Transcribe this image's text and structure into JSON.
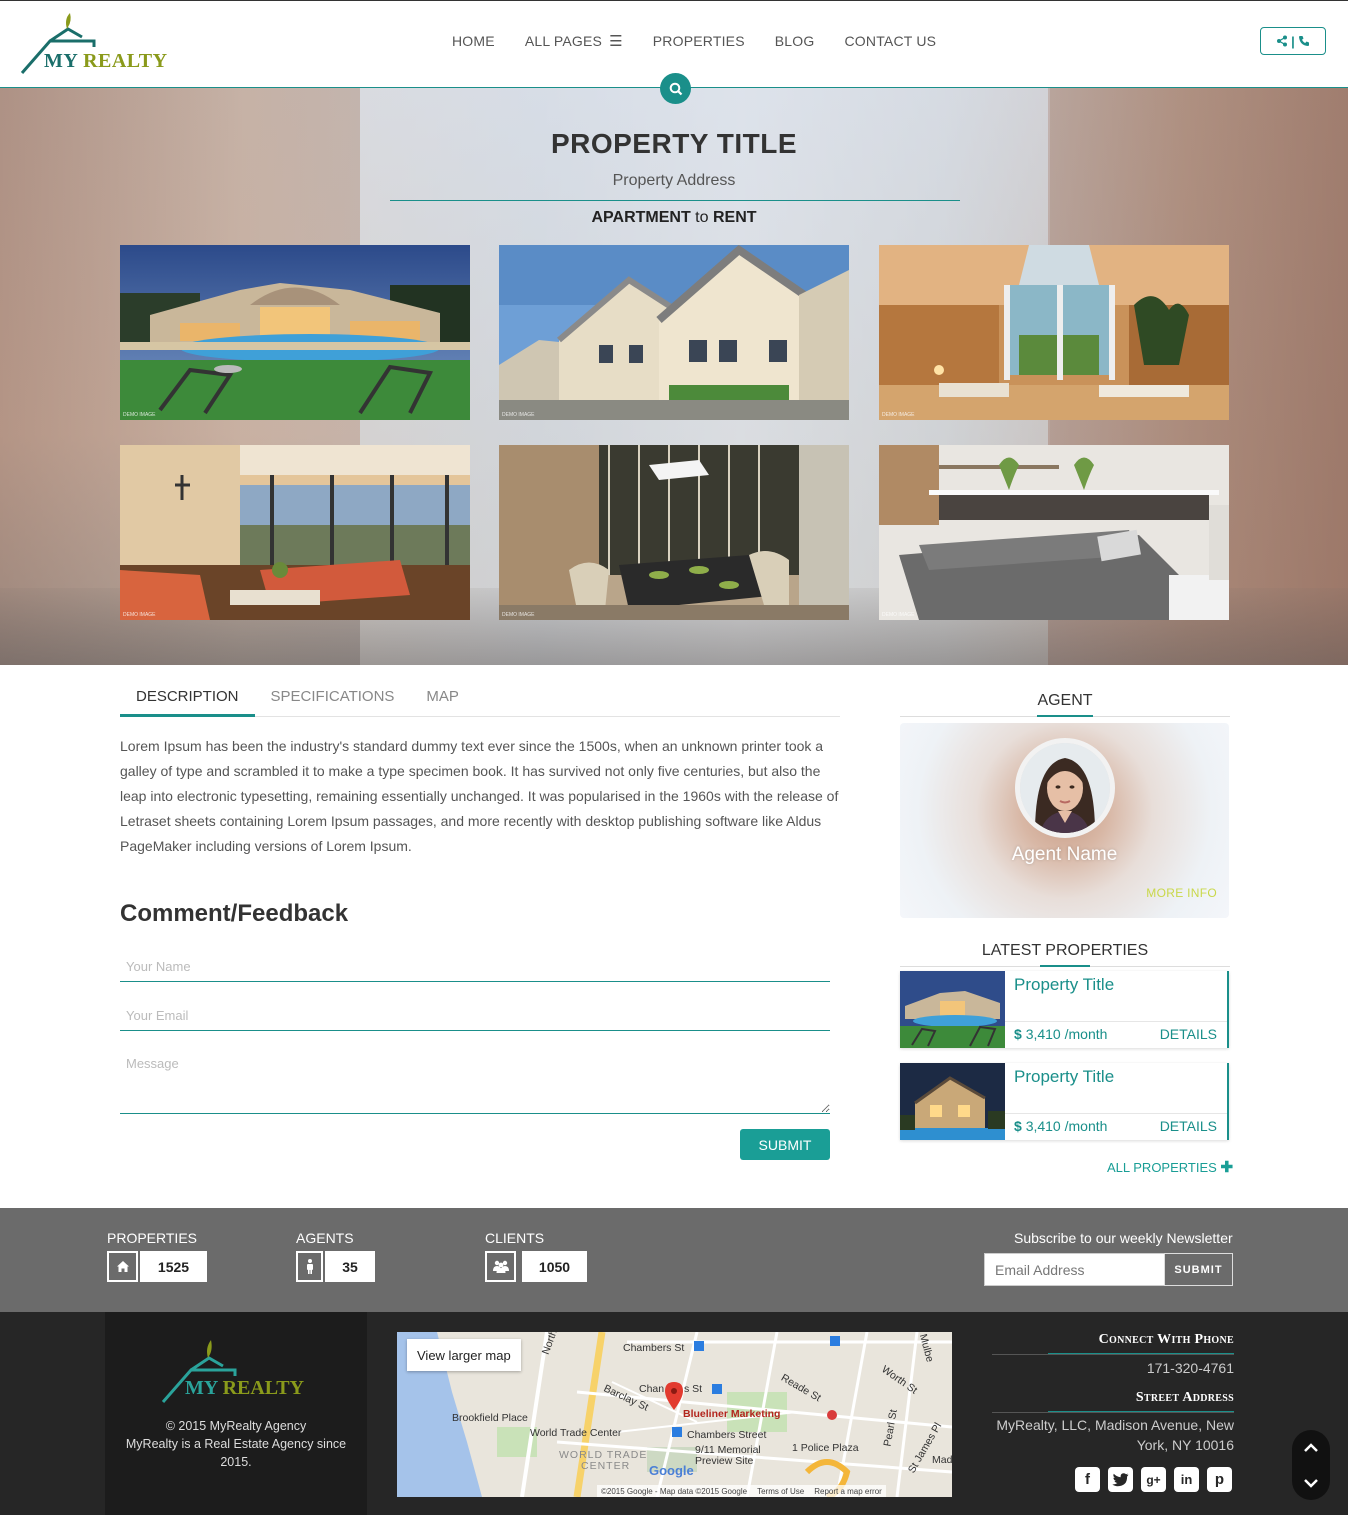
{
  "header": {
    "logo": {
      "my": "MY",
      "realty": "REALTY"
    },
    "nav": [
      {
        "label": "HOME"
      },
      {
        "label": "ALL PAGES"
      },
      {
        "label": "PROPERTIES"
      },
      {
        "label": "BLOG"
      },
      {
        "label": "CONTACT US"
      }
    ],
    "contact_button": "share-icon | phone-icon"
  },
  "hero": {
    "title": "PROPERTY TITLE",
    "address": "Property Address",
    "type_strong": "APARTMENT",
    "type_mid": "to",
    "type_end": "RENT",
    "demo_label": "DEMO IMAGE"
  },
  "tabs": [
    "DESCRIPTION",
    "SPECIFICATIONS",
    "MAP"
  ],
  "description": "Lorem Ipsum has been the industry's standard dummy text ever since the 1500s, when an unknown printer took a galley of type and scrambled it to make a type specimen book. It has survived not only five centuries, but also the leap into electronic typesetting, remaining essentially unchanged. It was popularised in the 1960s with the release of Letraset sheets containing Lorem Ipsum passages, and more recently with desktop publishing software like Aldus PageMaker including versions of Lorem Ipsum.",
  "comment": {
    "title": "Comment/Feedback",
    "name_placeholder": "Your Name",
    "email_placeholder": "Your Email",
    "message_placeholder": "Message",
    "submit": "SUBMIT"
  },
  "agent": {
    "heading": "AGENT",
    "name": "Agent Name",
    "more": "MORE INFO"
  },
  "latest": {
    "heading": "LATEST PROPERTIES",
    "items": [
      {
        "title": "Property Title",
        "currency": "$",
        "price": "3,410 /month",
        "details": "DETAILS"
      },
      {
        "title": "Property Title",
        "currency": "$",
        "price": "3,410 /month",
        "details": "DETAILS"
      }
    ],
    "all_link": "ALL PROPERTIES"
  },
  "stats": {
    "properties": {
      "label": "PROPERTIES",
      "value": "1525",
      "icon": "home-icon"
    },
    "agents": {
      "label": "AGENTS",
      "value": "35",
      "icon": "person-icon"
    },
    "clients": {
      "label": "CLIENTS",
      "value": "1050",
      "icon": "users-icon"
    },
    "newsletter": {
      "label": "Subscribe to our weekly Newsletter",
      "placeholder": "Email Address",
      "button": "SUBMIT"
    }
  },
  "footer": {
    "logo": {
      "my": "MY",
      "realty": "REALTY"
    },
    "copyright": "© 2015 MyRealty Agency",
    "tagline": "MyRealty is a Real Estate Agency since 2015.",
    "map": {
      "larger": "View larger map",
      "labels": {
        "chambers1": "Chambers St",
        "chambers2": "Chan",
        "chambers2b": "s St",
        "barclay": "Barclay St",
        "reade": "Reade St",
        "worth": "Worth St",
        "brookfield": "Brookfield Place",
        "blueliner": "Blueliner Marketing",
        "wtc": "World Trade Center",
        "chambers_street": "Chambers Street",
        "memorial": "9/11 Memorial",
        "preview": "Preview Site",
        "police": "1 Police Plaza",
        "wtc_area1": "WORLD TRADE",
        "wtc_area2": "CENTER",
        "google": "Google",
        "north": "North",
        "mulberry": "Mulbe",
        "pearl": "Pearl St",
        "stjames": "St James Pl",
        "mad": "Mad"
      },
      "attribution": "©2015 Google - Map data ©2015 Google",
      "terms": "Terms of Use",
      "report": "Report a map error"
    },
    "phone_heading": "Connect With Phone",
    "phone": "171-320-4761",
    "address_heading": "Street Address",
    "address_line1": "MyRealty, LLC, Madison Avenue, New",
    "address_line2": "York, NY 10016",
    "socials": [
      "f",
      "t",
      "g+",
      "in",
      "p"
    ]
  },
  "colors": {
    "accent": "#1a8f8a",
    "stats_bg": "#6b6b6b",
    "footer_bg": "#262626"
  }
}
